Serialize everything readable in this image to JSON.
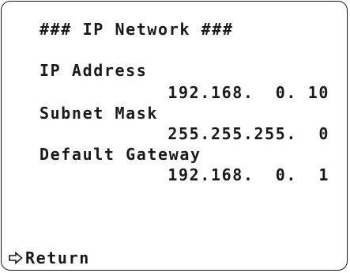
{
  "menu": {
    "title": "### IP Network ###"
  },
  "fields": {
    "ip_address": {
      "label": "IP Address",
      "value": "192.168.  0. 10"
    },
    "subnet_mask": {
      "label": "Subnet Mask",
      "value": "255.255.255.  0"
    },
    "default_gateway": {
      "label": "Default Gateway",
      "value": "192.168.  0.  1"
    }
  },
  "return": {
    "icon": "hollow-right-arrow-icon",
    "label": "Return"
  },
  "colors": {
    "text": "#1a1a1a",
    "background": "#ffffff",
    "border": "#1a1a1a"
  }
}
